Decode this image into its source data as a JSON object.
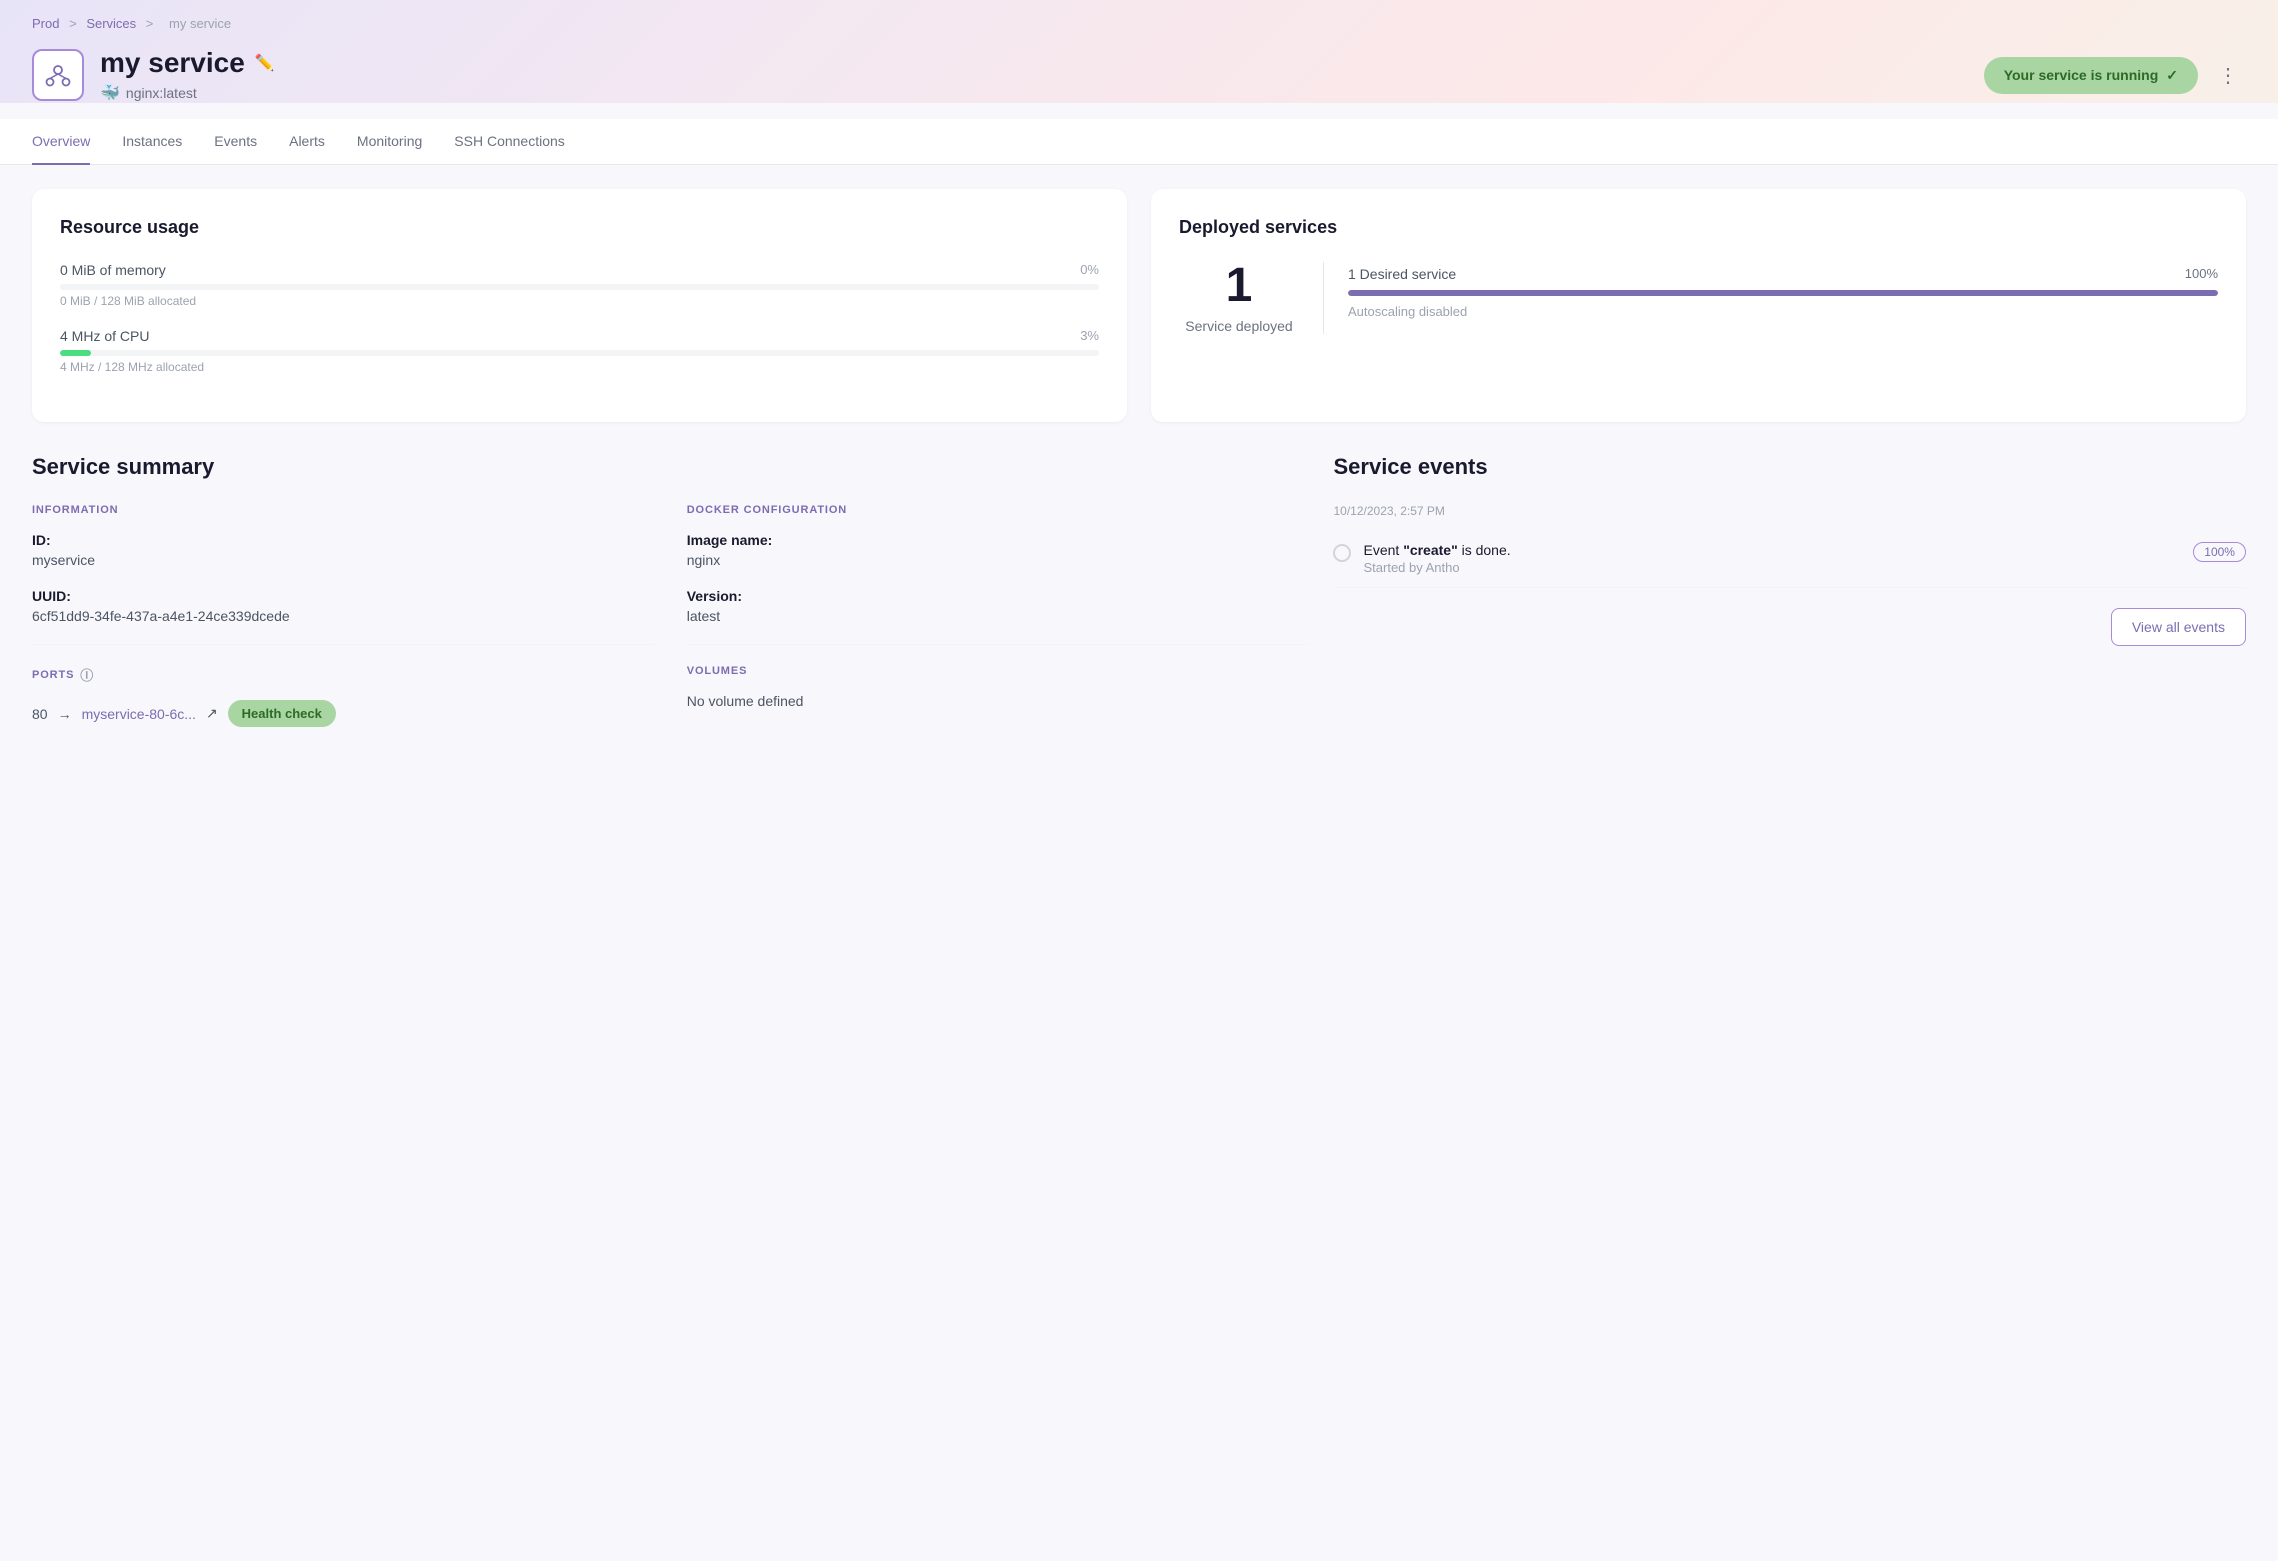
{
  "breadcrumb": {
    "prod": "Prod",
    "separator1": ">",
    "services": "Services",
    "separator2": ">",
    "current": "my service"
  },
  "service": {
    "name": "my service",
    "image": "nginx:latest",
    "status": "Your service is running"
  },
  "tabs": [
    {
      "label": "Overview",
      "active": true
    },
    {
      "label": "Instances"
    },
    {
      "label": "Events"
    },
    {
      "label": "Alerts"
    },
    {
      "label": "Monitoring"
    },
    {
      "label": "SSH Connections"
    }
  ],
  "resource_usage": {
    "title": "Resource usage",
    "memory": {
      "label": "0 MiB of memory",
      "pct_label": "0%",
      "pct_value": 0,
      "sub": "0 MiB / 128 MiB allocated"
    },
    "cpu": {
      "label": "4 MHz of CPU",
      "pct_label": "3%",
      "pct_value": 3,
      "sub": "4 MHz / 128 MHz allocated"
    }
  },
  "deployed_services": {
    "title": "Deployed services",
    "count": "1",
    "count_label": "Service deployed",
    "desired": "1 Desired service",
    "desired_pct": "100%",
    "autoscaling": "Autoscaling disabled"
  },
  "service_summary": {
    "title": "Service summary",
    "information_label": "INFORMATION",
    "id_label": "ID:",
    "id_value": "myservice",
    "uuid_label": "UUID:",
    "uuid_value": "6cf51dd9-34fe-437a-a4e1-24ce339dcede",
    "docker_label": "DOCKER CONFIGURATION",
    "image_label": "Image name:",
    "image_value": "nginx",
    "version_label": "Version:",
    "version_value": "latest",
    "ports_label": "PORTS",
    "volumes_label": "VOLUMES",
    "port_number": "80",
    "port_arrow": "→",
    "port_link": "myservice-80-6c...",
    "health_check": "Health check",
    "no_volume": "No volume defined"
  },
  "service_events": {
    "title": "Service events",
    "timestamp": "10/12/2023, 2:57 PM",
    "event_text_before": "Event ",
    "event_action": "\"create\"",
    "event_text_after": " is done.",
    "event_sub": "Started by Antho",
    "event_badge": "100%",
    "view_all": "View all events"
  },
  "colors": {
    "accent": "#7c6db0",
    "green": "#a8d5a2",
    "green_text": "#2d6a27"
  }
}
